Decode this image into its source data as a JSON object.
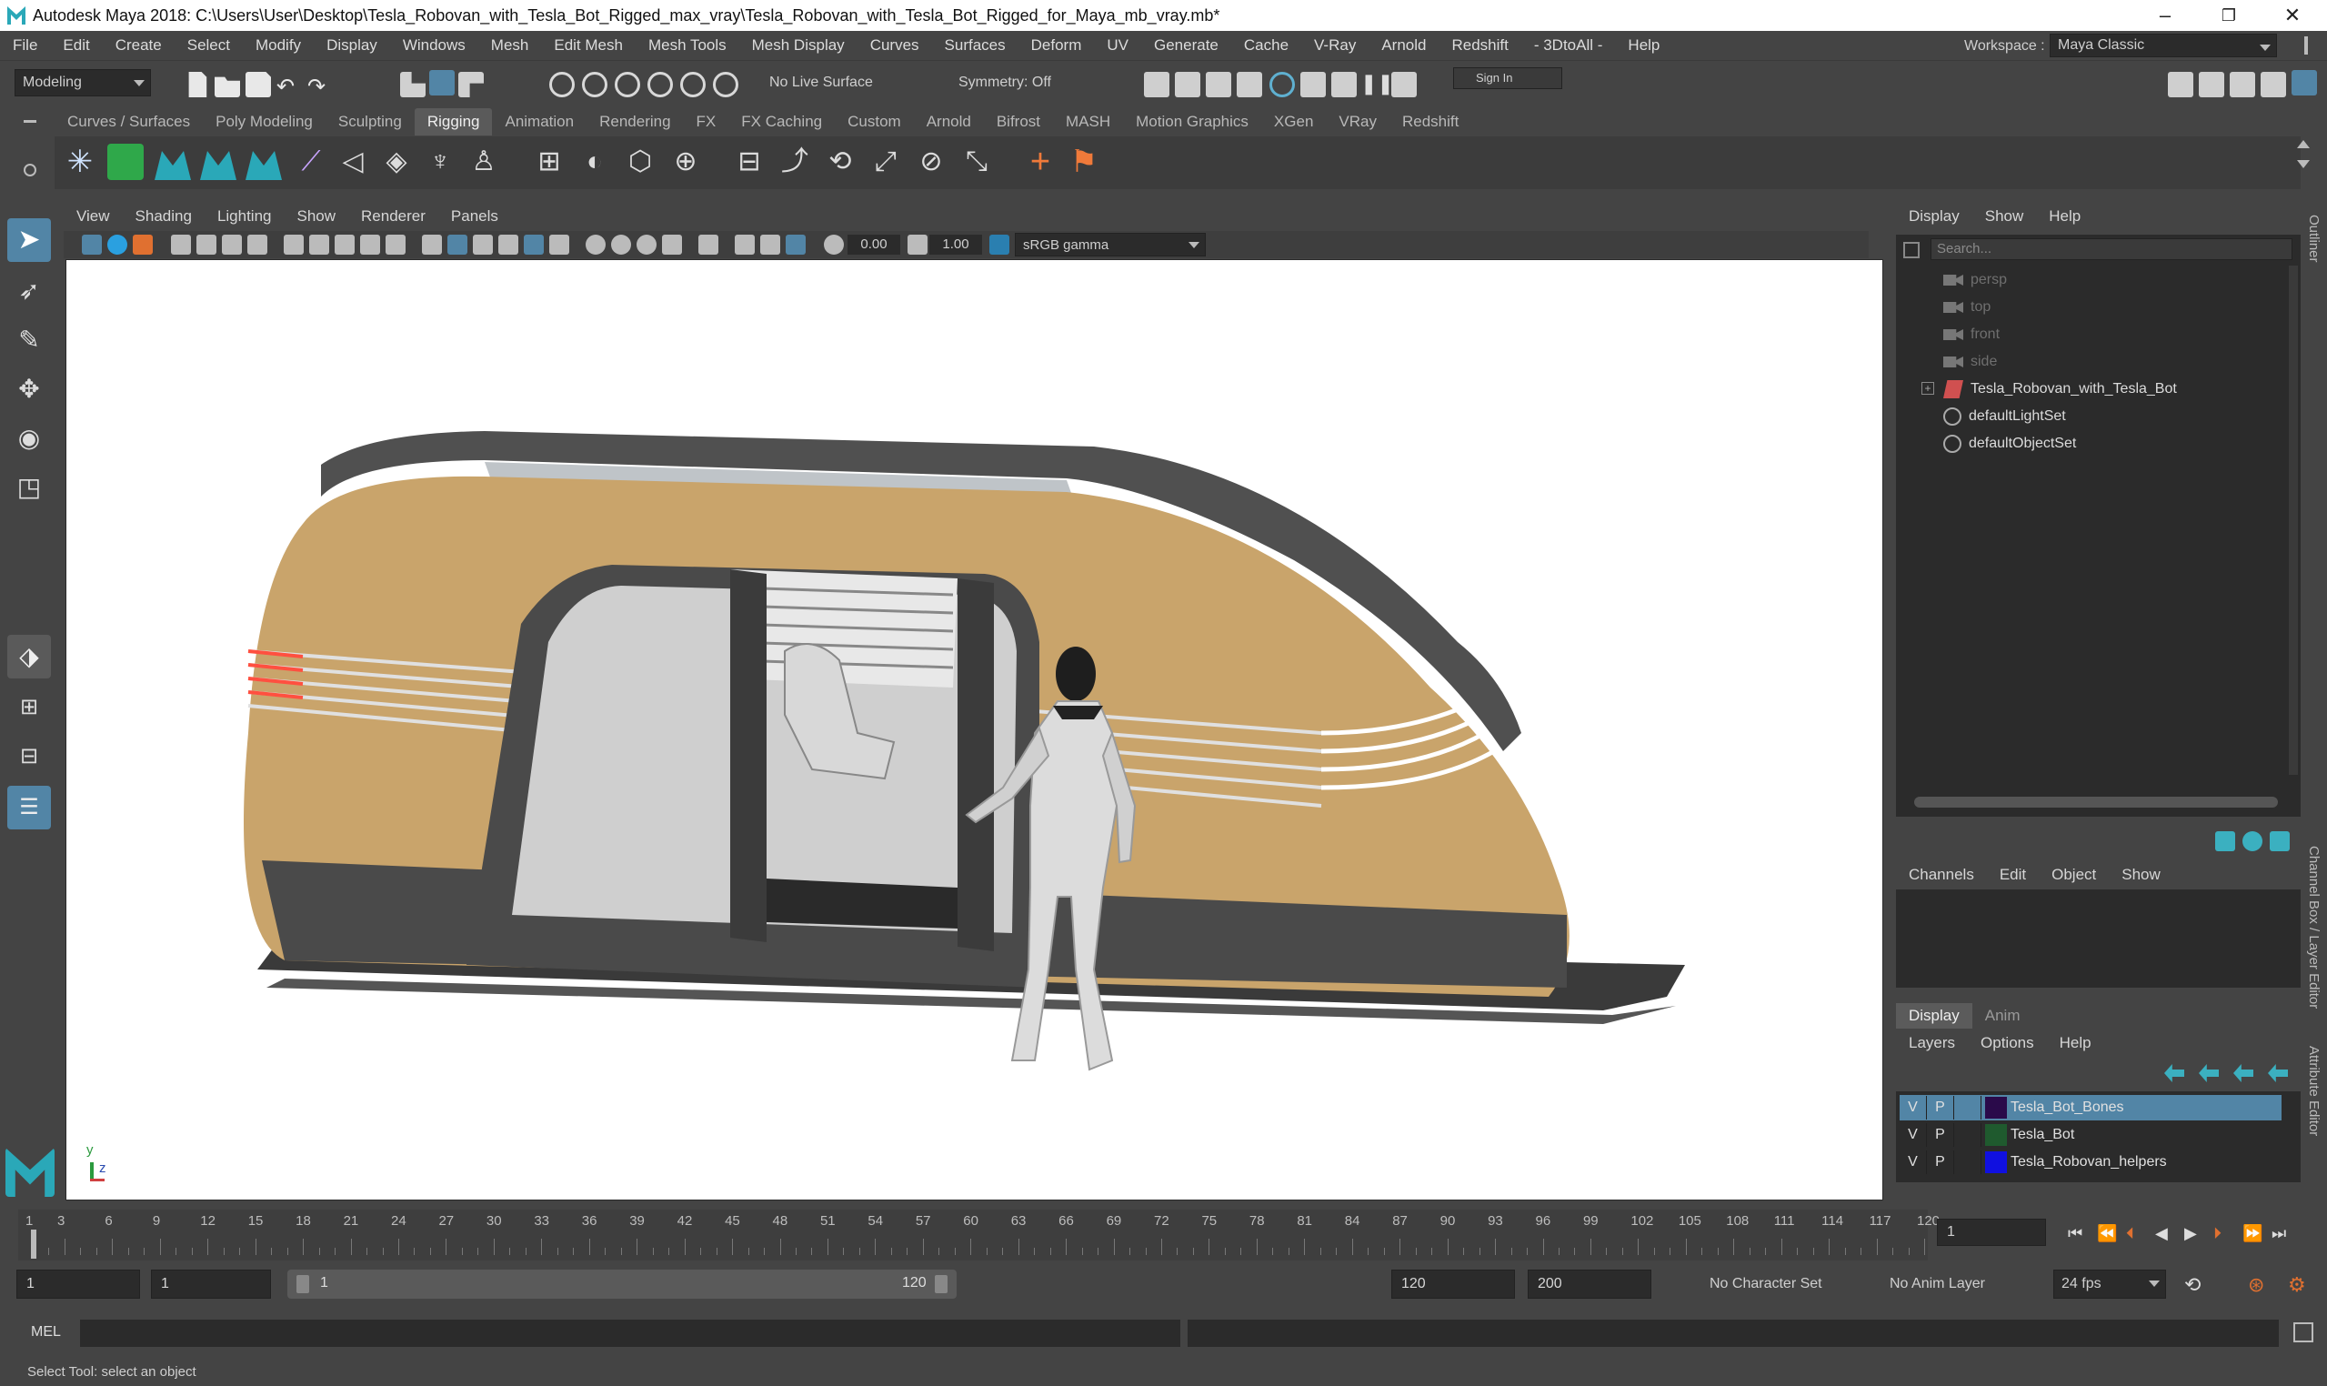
{
  "window": {
    "title": "Autodesk Maya 2018: C:\\Users\\User\\Desktop\\Tesla_Robovan_with_Tesla_Bot_Rigged_max_vray\\Tesla_Robovan_with_Tesla_Bot_Rigged_for_Maya_mb_vray.mb*",
    "minimize": "–",
    "restore": "❐",
    "close": "✕"
  },
  "menubar": {
    "items": [
      "File",
      "Edit",
      "Create",
      "Select",
      "Modify",
      "Display",
      "Windows",
      "Mesh",
      "Edit Mesh",
      "Mesh Tools",
      "Mesh Display",
      "Curves",
      "Surfaces",
      "Deform",
      "UV",
      "Generate",
      "Cache",
      "V-Ray",
      "Arnold",
      "Redshift",
      "- 3DtoAll -",
      "Help"
    ],
    "workspace_label": "Workspace :",
    "workspace_value": "Maya Classic"
  },
  "statusline": {
    "mode": "Modeling",
    "live_surface": "No Live Surface",
    "symmetry": "Symmetry: Off",
    "signin": "Sign In"
  },
  "shelf": {
    "tabs": [
      "Curves / Surfaces",
      "Poly Modeling",
      "Sculpting",
      "Rigging",
      "Animation",
      "Rendering",
      "FX",
      "FX Caching",
      "Custom",
      "Arnold",
      "Bifrost",
      "MASH",
      "Motion Graphics",
      "XGen",
      "VRay",
      "Redshift"
    ],
    "active_tab": "Rigging"
  },
  "viewport": {
    "menu": [
      "View",
      "Shading",
      "Lighting",
      "Show",
      "Renderer",
      "Panels"
    ],
    "exposure": "0.00",
    "gamma": "1.00",
    "colorspace": "sRGB gamma",
    "axis_y": "y",
    "axis_z": "z"
  },
  "outliner": {
    "menu": [
      "Display",
      "Show",
      "Help"
    ],
    "search_placeholder": "Search...",
    "items": [
      {
        "label": "persp",
        "dim": true
      },
      {
        "label": "top",
        "dim": true
      },
      {
        "label": "front",
        "dim": true
      },
      {
        "label": "side",
        "dim": true
      },
      {
        "label": "Tesla_Robovan_with_Tesla_Bot",
        "dim": false
      },
      {
        "label": "defaultLightSet",
        "dim": false
      },
      {
        "label": "defaultObjectSet",
        "dim": false
      }
    ],
    "side_tab": "Outliner"
  },
  "channelbox": {
    "menu": [
      "Channels",
      "Edit",
      "Object",
      "Show"
    ],
    "side_tab": "Channel Box / Layer Editor",
    "side_tab2": "Attribute Editor"
  },
  "layers": {
    "tabs": [
      "Display",
      "Anim"
    ],
    "menu": [
      "Layers",
      "Options",
      "Help"
    ],
    "rows": [
      {
        "v": "V",
        "p": "P",
        "name": "Tesla_Bot_Bones",
        "color": "#2a0a4a",
        "selected": true
      },
      {
        "v": "V",
        "p": "P",
        "name": "Tesla_Bot",
        "color": "#1f5a2e",
        "selected": false
      },
      {
        "v": "V",
        "p": "P",
        "name": "Tesla_Robovan_helpers",
        "color": "#1010e0",
        "selected": false
      }
    ]
  },
  "timeline": {
    "ticks": [
      "1",
      "3",
      "6",
      "9",
      "12",
      "15",
      "18",
      "21",
      "24",
      "27",
      "30",
      "33",
      "36",
      "39",
      "42",
      "45",
      "48",
      "51",
      "54",
      "57",
      "60",
      "63",
      "66",
      "69",
      "72",
      "75",
      "78",
      "81",
      "84",
      "87",
      "90",
      "93",
      "96",
      "99",
      "102",
      "105",
      "108",
      "111",
      "114",
      "117",
      "120"
    ],
    "current_frame": "1"
  },
  "range": {
    "start": "1",
    "playback_start": "1",
    "slider_start": "1",
    "slider_end": "120",
    "playback_end": "120",
    "end": "200",
    "character_set": "No Character Set",
    "anim_layer": "No Anim Layer",
    "fps": "24 fps"
  },
  "mel": {
    "label": "MEL"
  },
  "status": {
    "help": "Select Tool: select an object"
  },
  "colors": {
    "van_body": "#c9a46b",
    "van_trim": "#4a4a4a",
    "accent_blue": "#5285a6",
    "maya_teal": "#2aa8b8"
  }
}
